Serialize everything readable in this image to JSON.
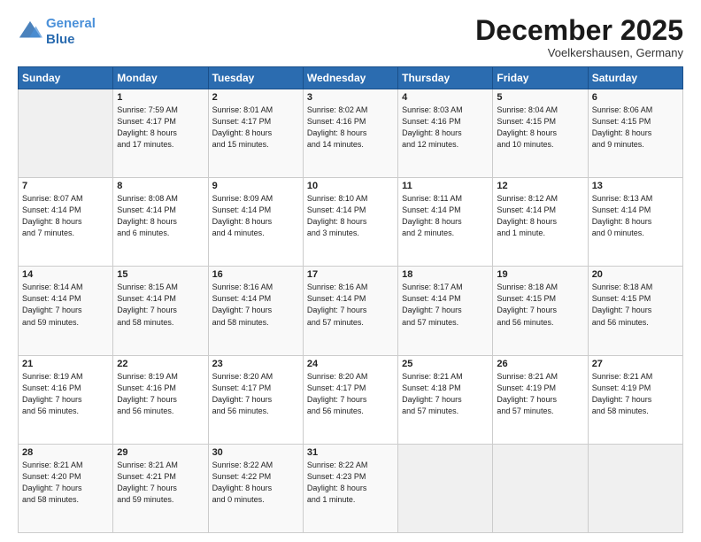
{
  "logo": {
    "line1": "General",
    "line2": "Blue"
  },
  "title": "December 2025",
  "location": "Voelkershausen, Germany",
  "days_header": [
    "Sunday",
    "Monday",
    "Tuesday",
    "Wednesday",
    "Thursday",
    "Friday",
    "Saturday"
  ],
  "weeks": [
    [
      {
        "day": "",
        "info": ""
      },
      {
        "day": "1",
        "info": "Sunrise: 7:59 AM\nSunset: 4:17 PM\nDaylight: 8 hours\nand 17 minutes."
      },
      {
        "day": "2",
        "info": "Sunrise: 8:01 AM\nSunset: 4:17 PM\nDaylight: 8 hours\nand 15 minutes."
      },
      {
        "day": "3",
        "info": "Sunrise: 8:02 AM\nSunset: 4:16 PM\nDaylight: 8 hours\nand 14 minutes."
      },
      {
        "day": "4",
        "info": "Sunrise: 8:03 AM\nSunset: 4:16 PM\nDaylight: 8 hours\nand 12 minutes."
      },
      {
        "day": "5",
        "info": "Sunrise: 8:04 AM\nSunset: 4:15 PM\nDaylight: 8 hours\nand 10 minutes."
      },
      {
        "day": "6",
        "info": "Sunrise: 8:06 AM\nSunset: 4:15 PM\nDaylight: 8 hours\nand 9 minutes."
      }
    ],
    [
      {
        "day": "7",
        "info": "Sunrise: 8:07 AM\nSunset: 4:14 PM\nDaylight: 8 hours\nand 7 minutes."
      },
      {
        "day": "8",
        "info": "Sunrise: 8:08 AM\nSunset: 4:14 PM\nDaylight: 8 hours\nand 6 minutes."
      },
      {
        "day": "9",
        "info": "Sunrise: 8:09 AM\nSunset: 4:14 PM\nDaylight: 8 hours\nand 4 minutes."
      },
      {
        "day": "10",
        "info": "Sunrise: 8:10 AM\nSunset: 4:14 PM\nDaylight: 8 hours\nand 3 minutes."
      },
      {
        "day": "11",
        "info": "Sunrise: 8:11 AM\nSunset: 4:14 PM\nDaylight: 8 hours\nand 2 minutes."
      },
      {
        "day": "12",
        "info": "Sunrise: 8:12 AM\nSunset: 4:14 PM\nDaylight: 8 hours\nand 1 minute."
      },
      {
        "day": "13",
        "info": "Sunrise: 8:13 AM\nSunset: 4:14 PM\nDaylight: 8 hours\nand 0 minutes."
      }
    ],
    [
      {
        "day": "14",
        "info": "Sunrise: 8:14 AM\nSunset: 4:14 PM\nDaylight: 7 hours\nand 59 minutes."
      },
      {
        "day": "15",
        "info": "Sunrise: 8:15 AM\nSunset: 4:14 PM\nDaylight: 7 hours\nand 58 minutes."
      },
      {
        "day": "16",
        "info": "Sunrise: 8:16 AM\nSunset: 4:14 PM\nDaylight: 7 hours\nand 58 minutes."
      },
      {
        "day": "17",
        "info": "Sunrise: 8:16 AM\nSunset: 4:14 PM\nDaylight: 7 hours\nand 57 minutes."
      },
      {
        "day": "18",
        "info": "Sunrise: 8:17 AM\nSunset: 4:14 PM\nDaylight: 7 hours\nand 57 minutes."
      },
      {
        "day": "19",
        "info": "Sunrise: 8:18 AM\nSunset: 4:15 PM\nDaylight: 7 hours\nand 56 minutes."
      },
      {
        "day": "20",
        "info": "Sunrise: 8:18 AM\nSunset: 4:15 PM\nDaylight: 7 hours\nand 56 minutes."
      }
    ],
    [
      {
        "day": "21",
        "info": "Sunrise: 8:19 AM\nSunset: 4:16 PM\nDaylight: 7 hours\nand 56 minutes."
      },
      {
        "day": "22",
        "info": "Sunrise: 8:19 AM\nSunset: 4:16 PM\nDaylight: 7 hours\nand 56 minutes."
      },
      {
        "day": "23",
        "info": "Sunrise: 8:20 AM\nSunset: 4:17 PM\nDaylight: 7 hours\nand 56 minutes."
      },
      {
        "day": "24",
        "info": "Sunrise: 8:20 AM\nSunset: 4:17 PM\nDaylight: 7 hours\nand 56 minutes."
      },
      {
        "day": "25",
        "info": "Sunrise: 8:21 AM\nSunset: 4:18 PM\nDaylight: 7 hours\nand 57 minutes."
      },
      {
        "day": "26",
        "info": "Sunrise: 8:21 AM\nSunset: 4:19 PM\nDaylight: 7 hours\nand 57 minutes."
      },
      {
        "day": "27",
        "info": "Sunrise: 8:21 AM\nSunset: 4:19 PM\nDaylight: 7 hours\nand 58 minutes."
      }
    ],
    [
      {
        "day": "28",
        "info": "Sunrise: 8:21 AM\nSunset: 4:20 PM\nDaylight: 7 hours\nand 58 minutes."
      },
      {
        "day": "29",
        "info": "Sunrise: 8:21 AM\nSunset: 4:21 PM\nDaylight: 7 hours\nand 59 minutes."
      },
      {
        "day": "30",
        "info": "Sunrise: 8:22 AM\nSunset: 4:22 PM\nDaylight: 8 hours\nand 0 minutes."
      },
      {
        "day": "31",
        "info": "Sunrise: 8:22 AM\nSunset: 4:23 PM\nDaylight: 8 hours\nand 1 minute."
      },
      {
        "day": "",
        "info": ""
      },
      {
        "day": "",
        "info": ""
      },
      {
        "day": "",
        "info": ""
      }
    ]
  ]
}
